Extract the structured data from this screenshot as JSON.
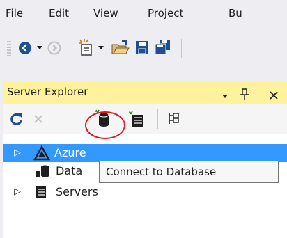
{
  "menubar": {
    "items": [
      "File",
      "Edit",
      "View",
      "Project",
      "Bu"
    ]
  },
  "toolbar": {
    "icons": [
      "back-icon",
      "dropdown-arrow-icon",
      "forward-icon",
      "new-item-icon",
      "open-folder-icon",
      "save-icon",
      "save-all-icon"
    ]
  },
  "server_explorer": {
    "title": "Server Explorer",
    "header_icons": [
      "dropdown-arrow-icon",
      "pin-icon",
      "close-icon"
    ],
    "toolbar_icons": [
      "refresh-icon",
      "stop-icon",
      "connect-to-database-icon",
      "connect-to-server-icon",
      "properties-icon"
    ],
    "tree": [
      {
        "label": "Azure",
        "icon": "azure-icon",
        "expander": "▷",
        "selected": true
      },
      {
        "label": "Data",
        "icon": "data-connections-icon",
        "expander": "",
        "selected": false
      },
      {
        "label": "Servers",
        "icon": "servers-icon",
        "expander": "▷",
        "selected": false
      }
    ]
  },
  "tooltip": {
    "text": "Connect to Database"
  },
  "colors": {
    "header_active": "#fff29d",
    "selection": "#3399ff",
    "highlight_ring": "#e8141e",
    "accent_blue": "#1e4f91"
  }
}
